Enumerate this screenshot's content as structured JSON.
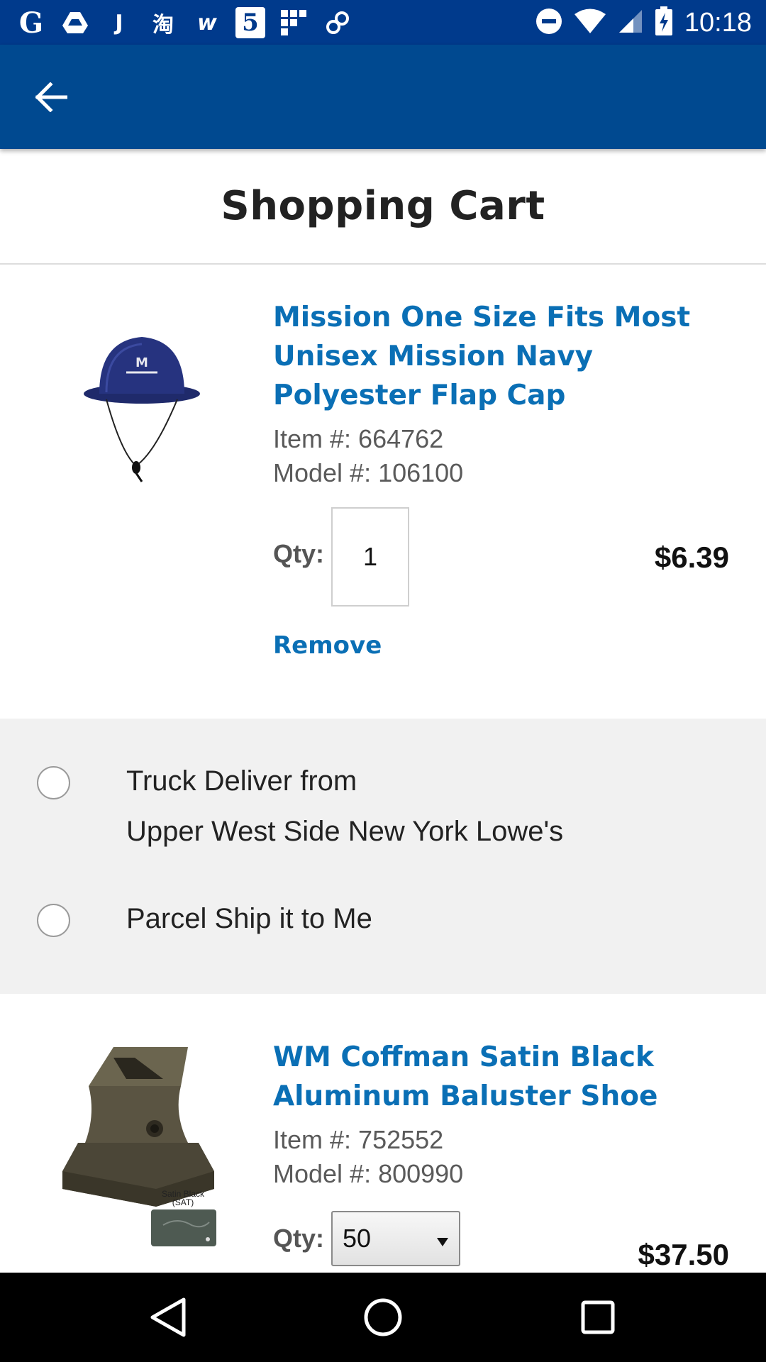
{
  "status_bar": {
    "left_icons": [
      "G",
      "drive-icon",
      "J",
      "淘",
      "w",
      "5",
      "grid-app-icon",
      "link-icon"
    ],
    "time": "10:18"
  },
  "page": {
    "title": "Shopping Cart"
  },
  "cart_items": [
    {
      "name": "Mission One Size Fits Most Unisex Mission Navy Polyester Flap Cap",
      "item_number": "Item #: 664762",
      "model_number": "Model #: 106100",
      "qty_label": "Qty:",
      "qty": "1",
      "price": "$6.39",
      "remove_label": "Remove"
    },
    {
      "name": "WM Coffman Satin Black Aluminum Baluster Shoe",
      "item_number": "Item #: 752552",
      "model_number": "Model #: 800990",
      "qty_label": "Qty:",
      "qty": "50",
      "price": "$37.50",
      "image_caption": "Satin Black (SAT)"
    }
  ],
  "delivery_options": [
    {
      "line1": "Truck Deliver from",
      "line2": "Upper West Side New York Lowe's",
      "selected": false
    },
    {
      "line1": "Parcel Ship it to Me",
      "selected": false
    }
  ],
  "colors": {
    "status_bar": "#003a8c",
    "app_bar": "#004990",
    "link": "#0a6fb5"
  }
}
